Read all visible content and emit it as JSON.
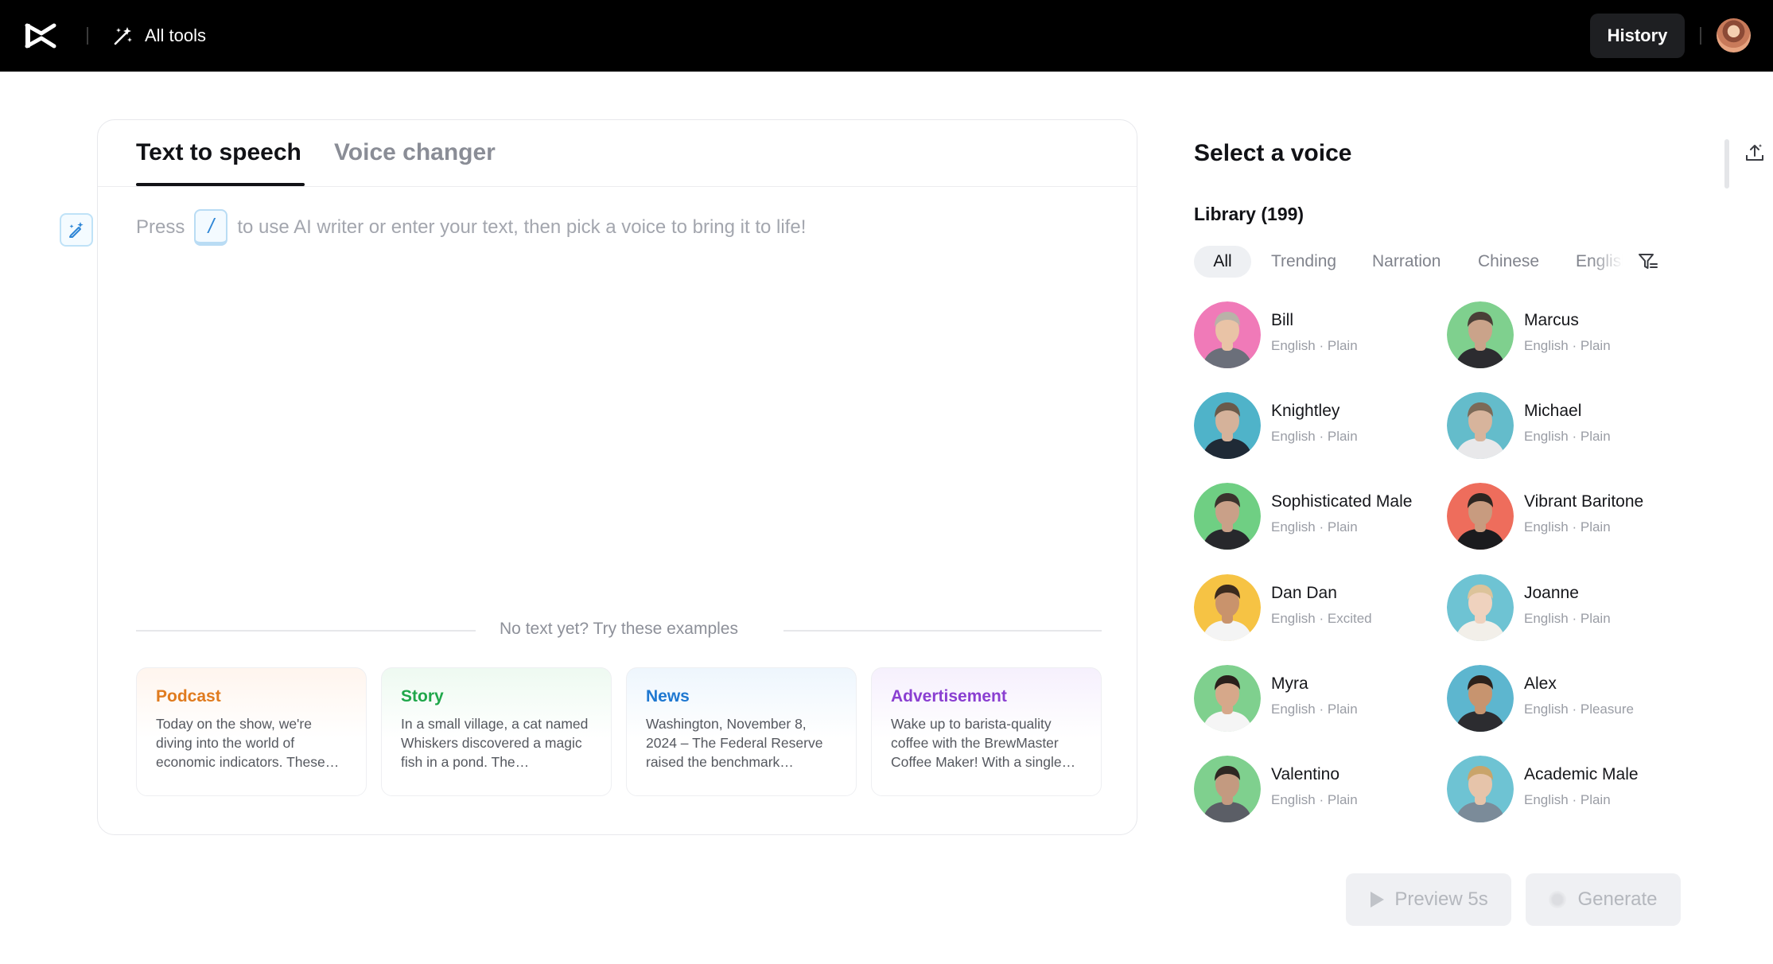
{
  "topbar": {
    "logo": "capcut-logo",
    "all_tools_label": "All tools",
    "history_label": "History"
  },
  "editor": {
    "tabs": [
      {
        "label": "Text to speech",
        "active": true
      },
      {
        "label": "Voice changer",
        "active": false
      }
    ],
    "prompt_before": "Press",
    "prompt_key": "/",
    "prompt_after": "to use AI writer or enter your text, then pick a voice to bring it to life!",
    "examples_heading": "No text yet? Try these examples",
    "examples": [
      {
        "title": "Podcast",
        "color": "#e07b1f",
        "body": "Today on the show, we're diving into the world of economic indicators. These…"
      },
      {
        "title": "Story",
        "color": "#1fa74a",
        "body": "In a small village, a cat named Whiskers discovered a magic fish in a pond. The…"
      },
      {
        "title": "News",
        "color": "#1f78d1",
        "body": "Washington, November 8, 2024 – The Federal Reserve raised the benchmark…"
      },
      {
        "title": "Advertisement",
        "color": "#8a3fd1",
        "body": "Wake up to barista-quality coffee with the BrewMaster Coffee Maker! With a single…"
      }
    ]
  },
  "voice_panel": {
    "title": "Select a voice",
    "library_label": "Library (199)",
    "filters": [
      "All",
      "Trending",
      "Narration",
      "Chinese",
      "English"
    ],
    "active_filter": "All",
    "voices": [
      {
        "name": "Bill",
        "desc": "English · Plain",
        "bg": "#f07ab8",
        "skin": "#e9c3a6",
        "hair": "#b9b2a8",
        "shirt": "#6b6f7a"
      },
      {
        "name": "Marcus",
        "desc": "English · Plain",
        "bg": "#7fd08e",
        "skin": "#caa38a",
        "hair": "#4a3f37",
        "shirt": "#2c2c30"
      },
      {
        "name": "Knightley",
        "desc": "English · Plain",
        "bg": "#4fb3c9",
        "skin": "#d5b29a",
        "hair": "#6a5a4a",
        "shirt": "#1f2a36"
      },
      {
        "name": "Michael",
        "desc": "English · Plain",
        "bg": "#64bccb",
        "skin": "#d7b49c",
        "hair": "#7c6a58",
        "shirt": "#e8e8ea"
      },
      {
        "name": "Sophisticated Male",
        "desc": "English · Plain",
        "bg": "#6fcf83",
        "skin": "#c9a088",
        "hair": "#3b332d",
        "shirt": "#27282c"
      },
      {
        "name": "Vibrant Baritone",
        "desc": "English · Plain",
        "bg": "#ee6d5c",
        "skin": "#c89b7f",
        "hair": "#2e2621",
        "shirt": "#1b1b1e"
      },
      {
        "name": "Dan Dan",
        "desc": "English · Excited",
        "bg": "#f6c344",
        "skin": "#c9936c",
        "hair": "#3b2a1e",
        "shirt": "#f4f4f4"
      },
      {
        "name": "Joanne",
        "desc": "English · Plain",
        "bg": "#6ec3d3",
        "skin": "#efd2be",
        "hair": "#dcc39a",
        "shirt": "#f2efe9"
      },
      {
        "name": "Myra",
        "desc": "English · Plain",
        "bg": "#7fd08e",
        "skin": "#d6a88a",
        "hair": "#2a201b",
        "shirt": "#f5f5f5"
      },
      {
        "name": "Alex",
        "desc": "English · Pleasure",
        "bg": "#5db6cf",
        "skin": "#c7946f",
        "hair": "#2c211b",
        "shirt": "#2c2c30"
      },
      {
        "name": "Valentino",
        "desc": "English · Plain",
        "bg": "#7fd08e",
        "skin": "#c39a80",
        "hair": "#2e2722",
        "shirt": "#5b5e66"
      },
      {
        "name": "Academic Male",
        "desc": "English · Plain",
        "bg": "#6ec3d3",
        "skin": "#e6c4aa",
        "hair": "#c9a46a",
        "shirt": "#7b8b99"
      }
    ]
  },
  "footer": {
    "preview_label": "Preview 5s",
    "generate_label": "Generate"
  }
}
